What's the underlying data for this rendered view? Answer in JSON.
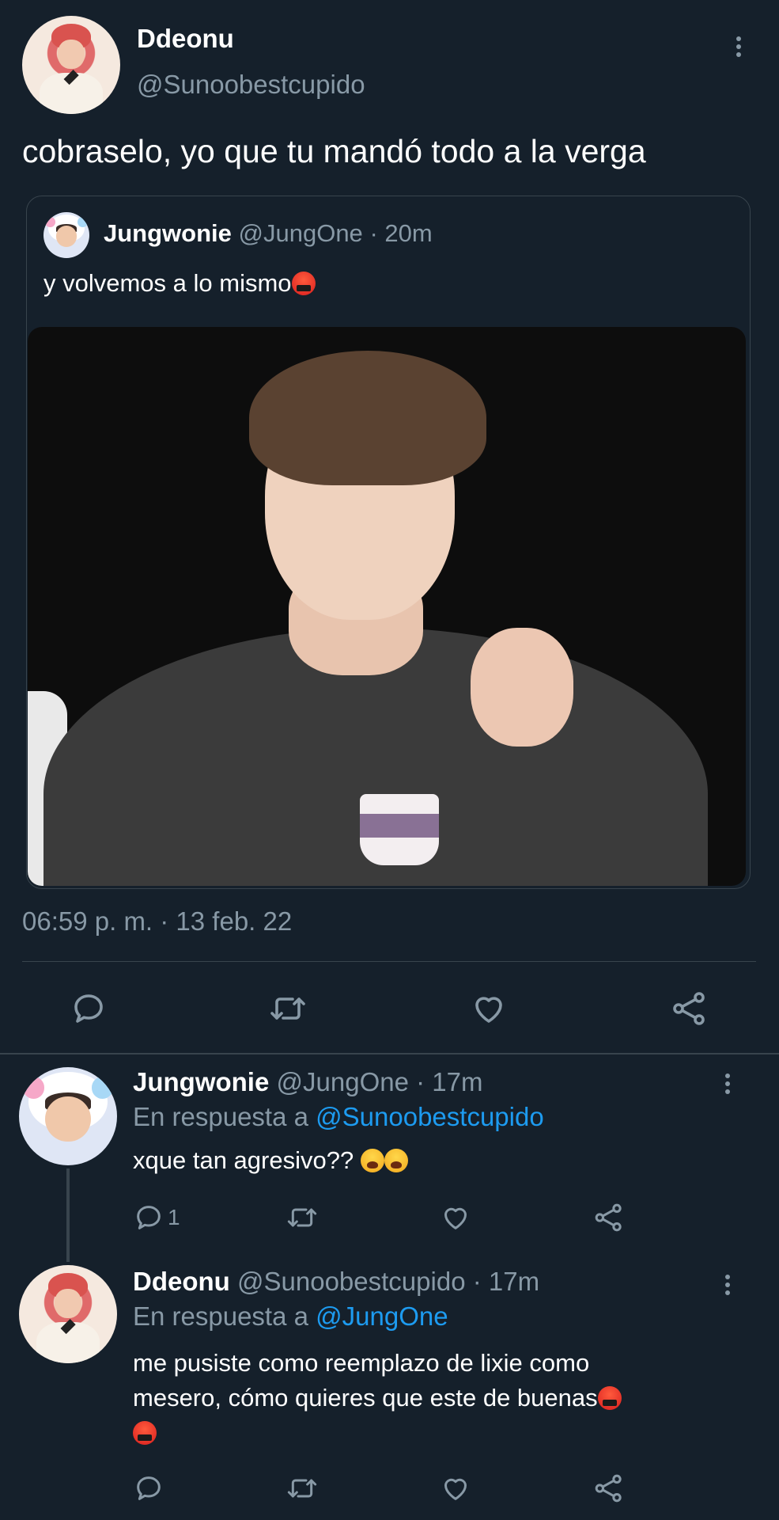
{
  "main_tweet": {
    "name": "Ddeonu",
    "handle": "@Sunoobestcupido",
    "text": "cobraselo, yo que tu mandó todo a la verga",
    "timestamp": "06:59 p. m. · 13 feb. 22",
    "more_icon": "kebab-icon"
  },
  "quoted_tweet": {
    "name": "Jungwonie",
    "handle": "@JungOne",
    "time": "· 20m",
    "text": "y volvemos a lo mismo"
  },
  "actions": {
    "reply_icon": "reply-icon",
    "retweet_icon": "retweet-icon",
    "like_icon": "heart-icon",
    "share_icon": "share-icon"
  },
  "replies": [
    {
      "name": "Jungwonie",
      "handle": "@JungOne",
      "time": "· 17m",
      "reply_prefix": "En respuesta a",
      "reply_to": "@Sunoobestcupido",
      "text": "xque tan agresivo??",
      "reply_count": "1"
    },
    {
      "name": "Ddeonu",
      "handle": "@Sunoobestcupido",
      "time": "· 17m",
      "reply_prefix": "En respuesta a",
      "reply_to": "@JungOne",
      "text_line1": "me pusiste como reemplazo de lixie como",
      "text_line2": "mesero, cómo quieres que este de buenas"
    }
  ],
  "colors": {
    "background": "#15202b",
    "muted": "#8899a6",
    "link": "#1d9bf0",
    "divider": "#38444d"
  }
}
